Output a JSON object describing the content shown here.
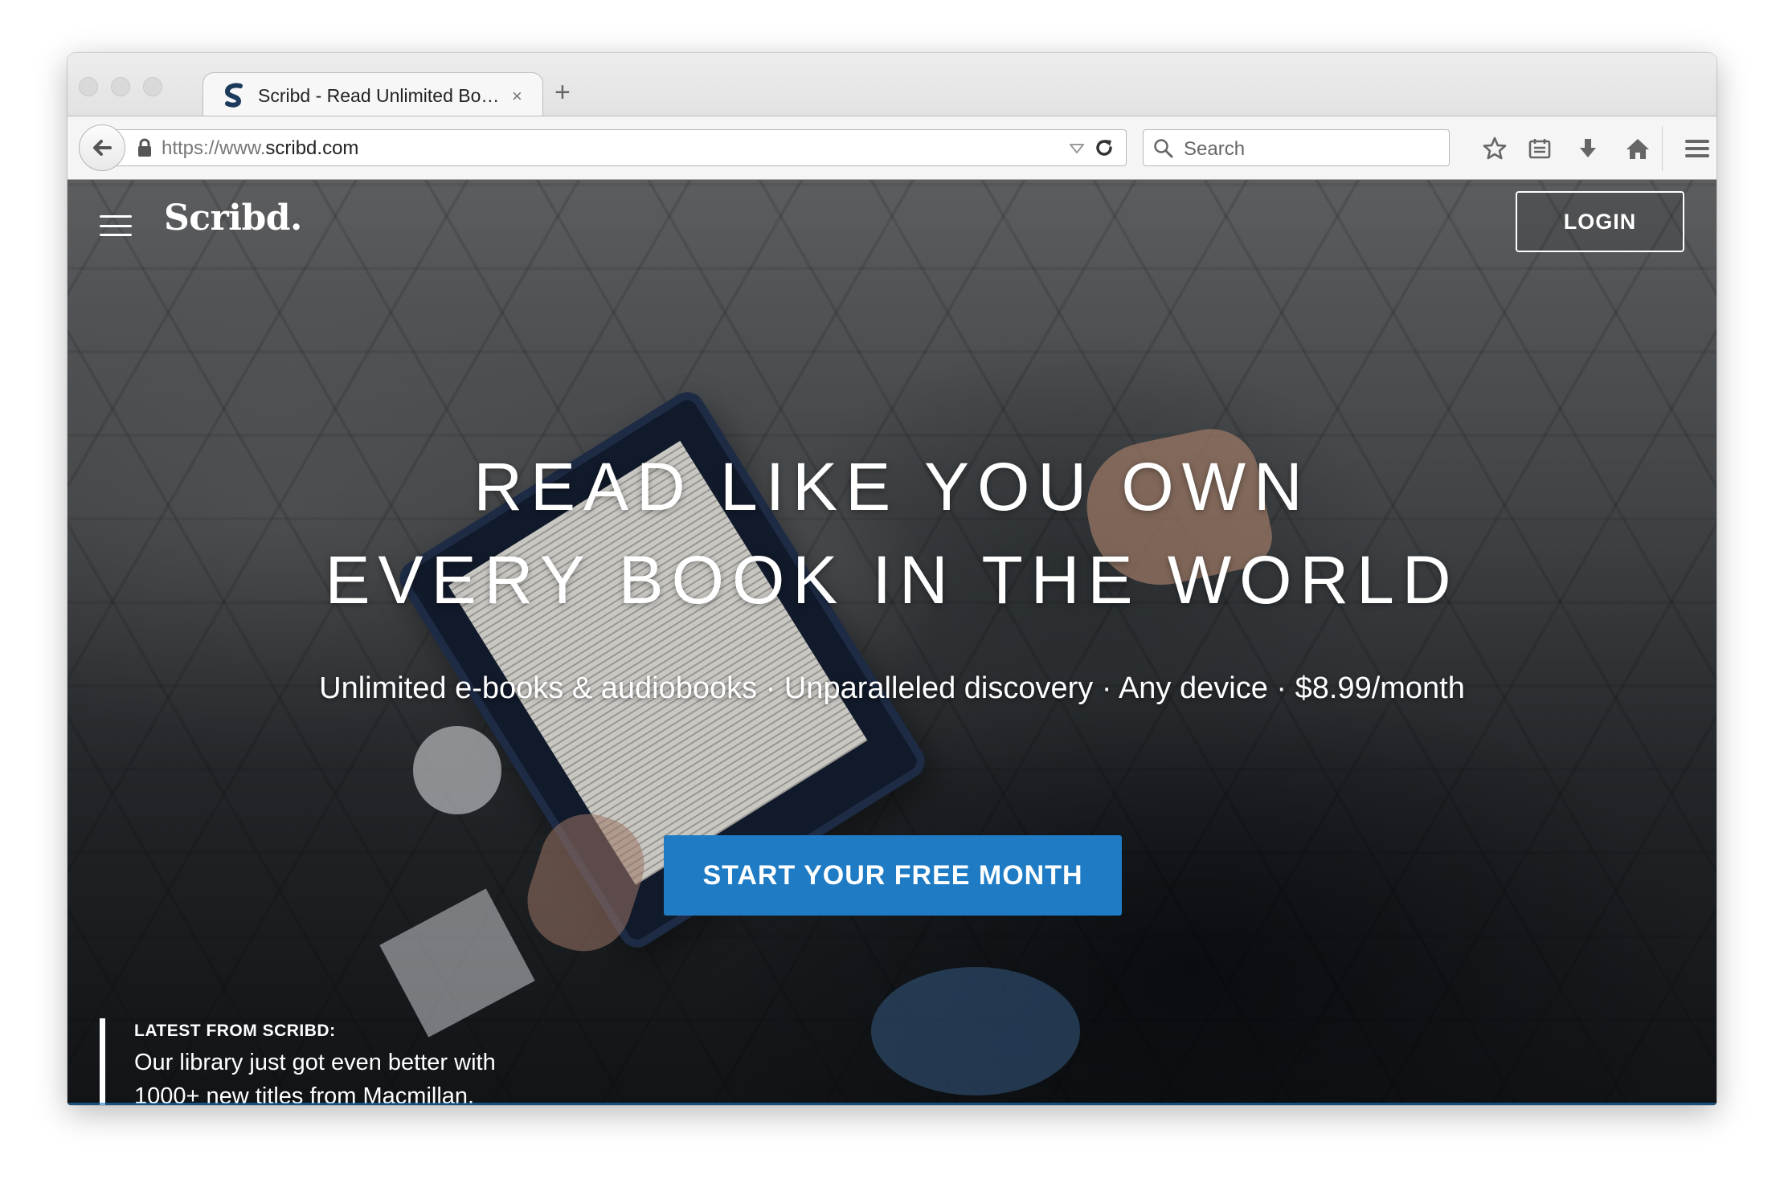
{
  "browser": {
    "tab": {
      "title": "Scribd - Read Unlimited Books, Audiobooks, Magazines and More",
      "close": "×"
    },
    "new_tab": "+",
    "url": {
      "scheme": "https://www.",
      "host": "scribd.com"
    },
    "search": {
      "placeholder": "Search"
    },
    "toolbar_icons": [
      "bookmark-star-icon",
      "reading-list-icon",
      "download-icon",
      "home-icon",
      "hamburger-menu-icon",
      "developer-tools-icon"
    ]
  },
  "site": {
    "logo": "Scribd.",
    "login_label": "LOGIN",
    "hero": {
      "line1": "READ LIKE YOU OWN",
      "line2": "EVERY BOOK IN THE WORLD",
      "subline": "Unlimited e-books & audiobooks · Unparalleled discovery · Any device · $8.99/month",
      "cta_label": "START YOUR FREE MONTH"
    },
    "latest": {
      "label": "LATEST FROM SCRIBD:",
      "text": "Our library just got even better with 1000+ new titles from Macmillan."
    }
  },
  "colors": {
    "accent": "#1e7bc4",
    "brand_favicon": "#1b3a5c"
  }
}
